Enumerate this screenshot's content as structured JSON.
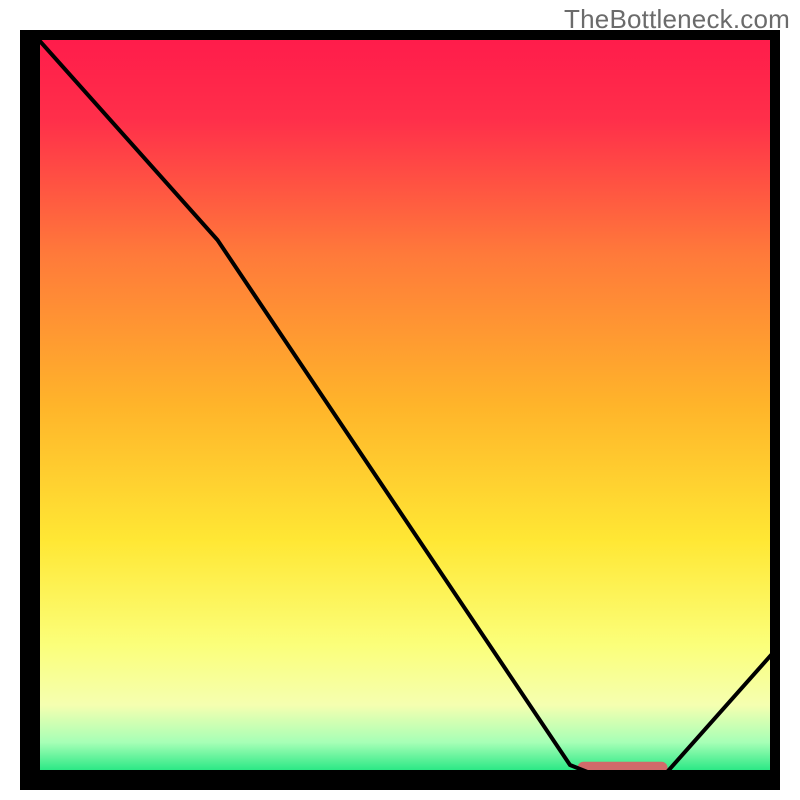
{
  "watermark": "TheBottleneck.com",
  "chart_data": {
    "type": "line",
    "title": "",
    "xlabel": "",
    "ylabel": "",
    "ylim": [
      0,
      100
    ],
    "xlim": [
      0,
      100
    ],
    "curve": {
      "name": "bottleneck-curve",
      "x": [
        0,
        25,
        72,
        77,
        84,
        100
      ],
      "y": [
        100,
        72,
        2,
        0,
        0,
        18
      ]
    },
    "optimum_band": {
      "x_start": 73,
      "x_end": 85,
      "y": 1.5,
      "color": "#d16a6a"
    },
    "background_gradient_stops": [
      {
        "offset": 0.0,
        "color": "#ff1a4b"
      },
      {
        "offset": 0.12,
        "color": "#ff2f4a"
      },
      {
        "offset": 0.3,
        "color": "#ff7a3a"
      },
      {
        "offset": 0.5,
        "color": "#ffb42a"
      },
      {
        "offset": 0.68,
        "color": "#ffe734"
      },
      {
        "offset": 0.82,
        "color": "#fbff7a"
      },
      {
        "offset": 0.9,
        "color": "#f5ffb0"
      },
      {
        "offset": 0.95,
        "color": "#a6ffb6"
      },
      {
        "offset": 1.0,
        "color": "#00e074"
      }
    ],
    "frame_color": "#000000"
  }
}
